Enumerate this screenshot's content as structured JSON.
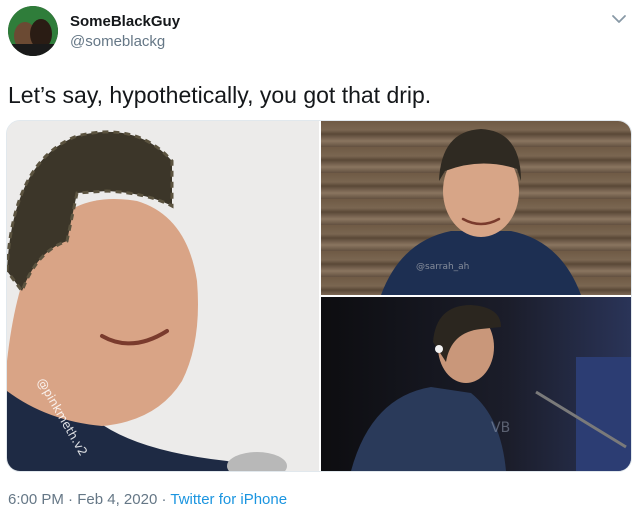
{
  "author": {
    "display_name": "SomeBlackGuy",
    "handle": "@someblackg"
  },
  "tweet": {
    "text": "Let’s say, hypothetically, you got that drip."
  },
  "media": {
    "photos": [
      {
        "watermark": "@pinkmeth.v2"
      },
      {
        "watermark": "@sarrah_ah"
      },
      {
        "watermark": "VB"
      }
    ]
  },
  "meta": {
    "time": "6:00 PM",
    "separator": "·",
    "date": "Feb 4, 2020",
    "source": "Twitter for iPhone"
  },
  "icons": {
    "caret": "chevron-down-icon"
  },
  "colors": {
    "text": "#14171a",
    "secondary": "#657786",
    "link": "#1b95e0",
    "border": "#e1e8ed"
  }
}
